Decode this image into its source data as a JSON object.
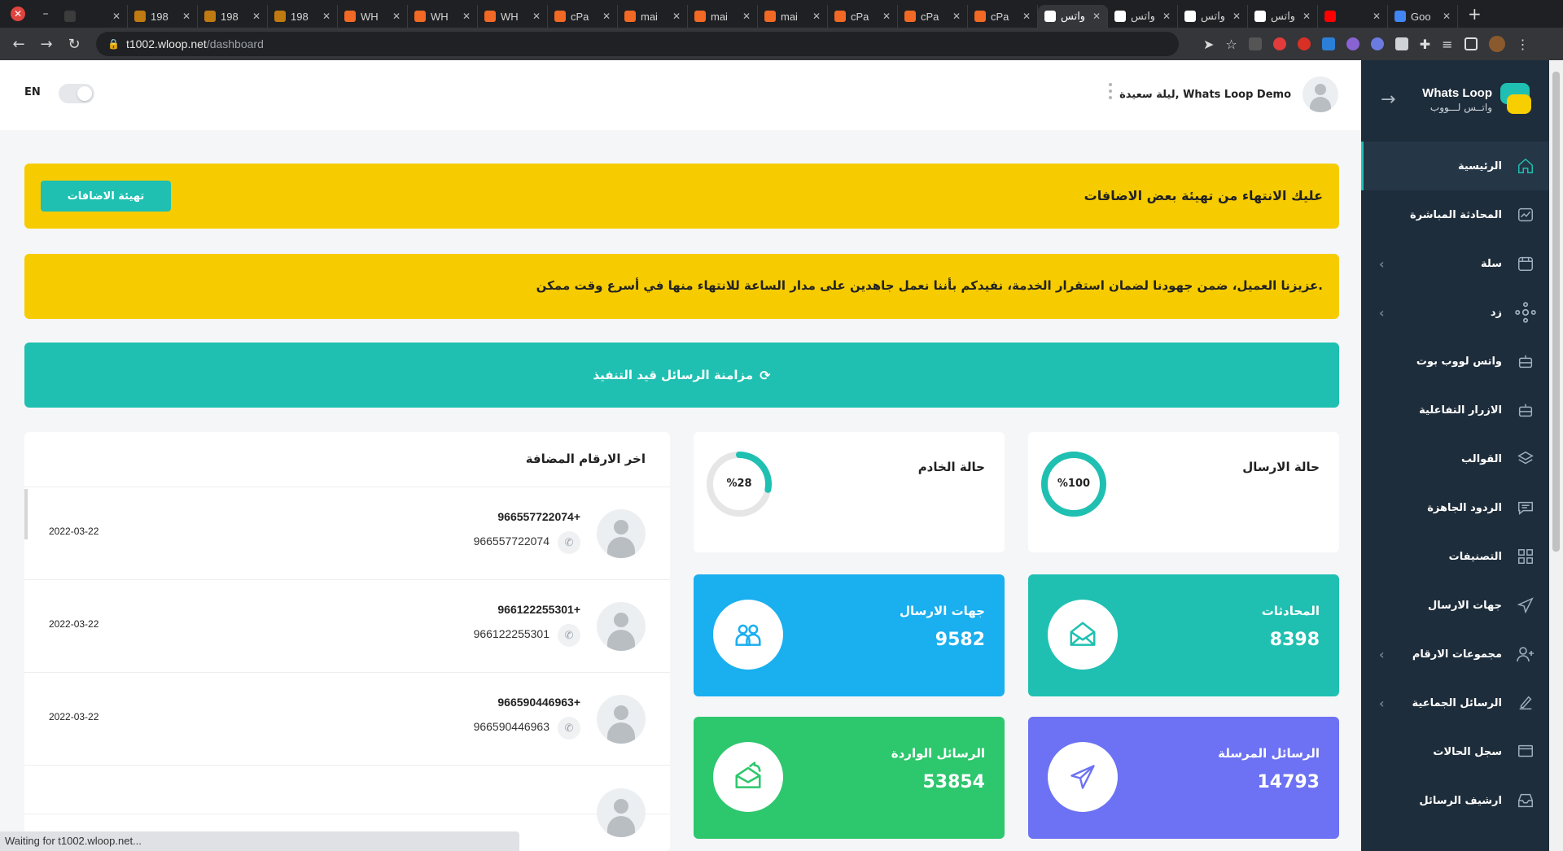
{
  "browser": {
    "tabs": [
      {
        "title": "",
        "favicon_color": "#3c3c3c"
      },
      {
        "title": "198",
        "favicon_color": "#c07a12"
      },
      {
        "title": "198",
        "favicon_color": "#c07a12"
      },
      {
        "title": "198",
        "favicon_color": "#c07a12"
      },
      {
        "title": "WH",
        "favicon_color": "#f16924"
      },
      {
        "title": "WH",
        "favicon_color": "#f16924"
      },
      {
        "title": "WH",
        "favicon_color": "#f16924"
      },
      {
        "title": "cPa",
        "favicon_color": "#f16924"
      },
      {
        "title": "mai",
        "favicon_color": "#f16924"
      },
      {
        "title": "mai",
        "favicon_color": "#f16924"
      },
      {
        "title": "mai",
        "favicon_color": "#f16924"
      },
      {
        "title": "cPa",
        "favicon_color": "#f16924"
      },
      {
        "title": "cPa",
        "favicon_color": "#f16924"
      },
      {
        "title": "cPa",
        "favicon_color": "#f16924"
      },
      {
        "title": "واتس",
        "favicon_color": "#ffffff",
        "active": true
      },
      {
        "title": "واتس",
        "favicon_color": "#ffffff"
      },
      {
        "title": "واتس",
        "favicon_color": "#ffffff"
      },
      {
        "title": "واتس",
        "favicon_color": "#ffffff"
      },
      {
        "title": "",
        "favicon_color": "#ff0000"
      },
      {
        "title": "Goo",
        "favicon_color": "#4285f4"
      }
    ],
    "url_host": "t1002.wloop.net",
    "url_path": "/dashboard",
    "status_text": "Waiting for t1002.wloop.net..."
  },
  "header": {
    "lang": "EN",
    "user_name": "ليلة سعيدة, Whats Loop Demo"
  },
  "sidebar": {
    "brand_en": "Whats Loop",
    "brand_ar": "واتــس لـــووب",
    "items": [
      {
        "label": "الرئيسية",
        "icon": "home-icon",
        "active": true,
        "chevron": false
      },
      {
        "label": "المحادثة المباشرة",
        "icon": "chart-line-icon",
        "chevron": false
      },
      {
        "label": "سلة",
        "icon": "basket-icon",
        "chevron": true
      },
      {
        "label": "زد",
        "icon": "network-icon",
        "chevron": true
      },
      {
        "label": "واتس لووب بوت",
        "icon": "bot-icon",
        "chevron": false
      },
      {
        "label": "الازرار التفاعلية",
        "icon": "robot-icon",
        "chevron": false
      },
      {
        "label": "القوالب",
        "icon": "layers-icon",
        "chevron": false
      },
      {
        "label": "الردود الجاهزة",
        "icon": "message-icon",
        "chevron": false
      },
      {
        "label": "التصنيفات",
        "icon": "grid-icon",
        "chevron": false
      },
      {
        "label": "جهات الارسال",
        "icon": "send-icon",
        "chevron": false
      },
      {
        "label": "مجموعات الارقام",
        "icon": "user-plus-icon",
        "chevron": true
      },
      {
        "label": "الرسائل الجماعية",
        "icon": "edit-icon",
        "chevron": true
      },
      {
        "label": "سجل الحالات",
        "icon": "monitor-icon",
        "chevron": false
      },
      {
        "label": "ارشيف الرسائل",
        "icon": "inbox-icon",
        "chevron": false
      }
    ]
  },
  "banners": {
    "setup_text": "عليك الانتهاء من تهيئة بعض الاضافات",
    "setup_button": "تهيئة الاضافات",
    "notice_text": "عزيزنا العميل، ضمن جهودنا لضمان استقرار الخدمة، نفيدكم بأننا نعمل جاهدين على مدار الساعة للانتهاء منها في أسرع وقت ممكن.",
    "sync_text": "مزامنة الرسائل قيد التنفيذ"
  },
  "status_cards": [
    {
      "title": "حالة الارسال",
      "percent_label": "%100",
      "percent": 100
    },
    {
      "title": "حالة الخادم",
      "percent_label": "%28",
      "percent": 28
    }
  ],
  "stats": [
    {
      "title": "المحادثات",
      "value": "8398",
      "color": "#1fc0b1",
      "icon": "envelope-open-icon"
    },
    {
      "title": "جهات الارسال",
      "value": "9582",
      "color": "#1aafef",
      "icon": "users-icon"
    },
    {
      "title": "الرسائل المرسلة",
      "value": "14793",
      "color": "#6c72f3",
      "icon": "paper-plane-icon"
    },
    {
      "title": "الرسائل الواردة",
      "value": "53854",
      "color": "#2dc76d",
      "icon": "mail-forward-icon"
    }
  ],
  "latest": {
    "title": "اخر الارقام المضافة",
    "rows": [
      {
        "number": "966557722074+",
        "plain": "966557722074",
        "date": "2022-03-22"
      },
      {
        "number": "966122255301+",
        "plain": "966122255301",
        "date": "2022-03-22"
      },
      {
        "number": "966590446963+",
        "plain": "966590446963",
        "date": "2022-03-22"
      }
    ]
  },
  "colors": {
    "teal": "#1fc0b1",
    "yellow": "#f6cc00",
    "sidebar": "#1e2d3b"
  }
}
